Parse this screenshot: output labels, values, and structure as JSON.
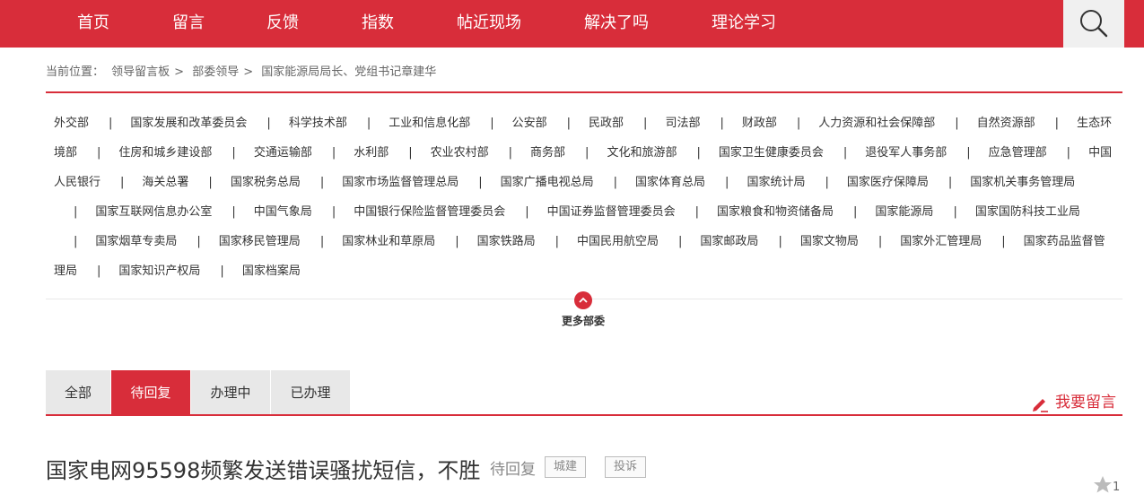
{
  "nav": {
    "items": [
      "首页",
      "留言",
      "反馈",
      "指数",
      "帖近现场",
      "解决了吗",
      "理论学习"
    ]
  },
  "icons": {
    "search": "search-icon",
    "more": "chevron-up-icon",
    "write": "pencil-icon",
    "star": "star-icon"
  },
  "colors": {
    "brand": "#d82d3a"
  },
  "breadcrumb": {
    "prefix": "当前位置：",
    "items": [
      "领导留言板",
      "部委领导",
      "国家能源局局长、党组书记章建华"
    ]
  },
  "departments": [
    "外交部",
    "国家发展和改革委员会",
    "科学技术部",
    "工业和信息化部",
    "公安部",
    "民政部",
    "司法部",
    "财政部",
    "人力资源和社会保障部",
    "自然资源部",
    "生态环境部",
    "住房和城乡建设部",
    "交通运输部",
    "水利部",
    "农业农村部",
    "商务部",
    "文化和旅游部",
    "国家卫生健康委员会",
    "退役军人事务部",
    "应急管理部",
    "中国人民银行",
    "海关总署",
    "国家税务总局",
    "国家市场监督管理总局",
    "国家广播电视总局",
    "国家体育总局",
    "国家统计局",
    "国家医疗保障局",
    "国家机关事务管理局",
    "国家互联网信息办公室",
    "中国气象局",
    "中国银行保险监督管理委员会",
    "中国证券监督管理委员会",
    "国家粮食和物资储备局",
    "国家能源局",
    "国家国防科技工业局",
    "国家烟草专卖局",
    "国家移民管理局",
    "国家林业和草原局",
    "国家铁路局",
    "中国民用航空局",
    "国家邮政局",
    "国家文物局",
    "国家外汇管理局",
    "国家药品监督管理局",
    "国家知识产权局",
    "国家档案局"
  ],
  "more": {
    "label": "更多部委"
  },
  "tabs": [
    "全部",
    "待回复",
    "办理中",
    "已办理"
  ],
  "write_button": {
    "label": "我要留言"
  },
  "message": {
    "title": "国家电网95598频繁发送错误骚扰短信，不胜",
    "status": "待回复",
    "tags": [
      "城建",
      "投诉"
    ],
    "star_count": "1"
  }
}
